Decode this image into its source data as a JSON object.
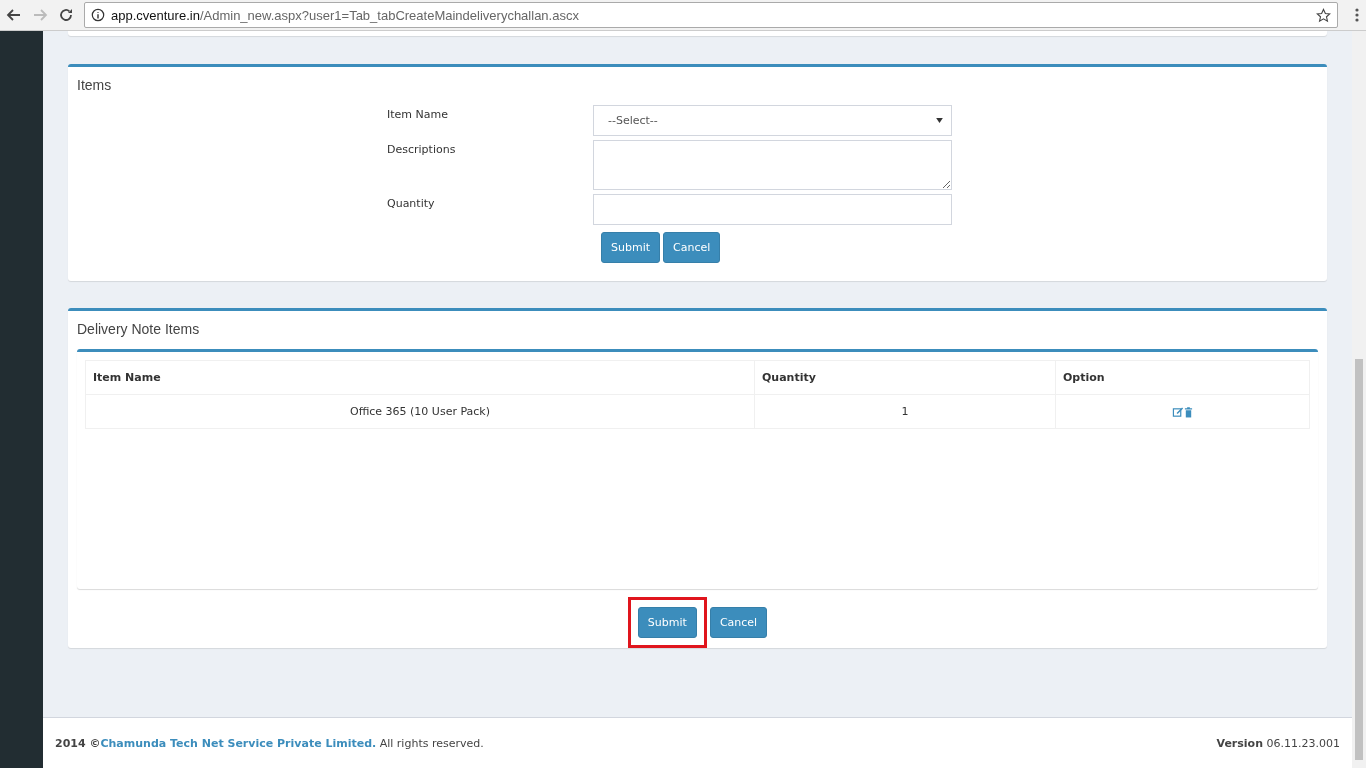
{
  "browser": {
    "url_host": "app.cventure.in",
    "url_path": "/Admin_new.aspx?user1=Tab_tabCreateMaindeliverychallan.ascx"
  },
  "items_form": {
    "title": "Items",
    "fields": [
      {
        "kind": "select",
        "label": "Item Name",
        "value": "--Select--"
      },
      {
        "kind": "textarea",
        "label": "Descriptions"
      },
      {
        "kind": "text",
        "label": "Quantity"
      }
    ],
    "buttons": [
      {
        "label": "Submit"
      },
      {
        "label": "Cancel"
      }
    ]
  },
  "delivery_items": {
    "title": "Delivery Note Items",
    "columns": [
      "Item Name",
      "Quantity",
      "Option"
    ],
    "rows": [
      {
        "item_name": "Office 365 (10 User Pack)",
        "quantity": "1"
      }
    ],
    "buttons": [
      {
        "label": "Submit",
        "highlighted": true
      },
      {
        "label": "Cancel",
        "highlighted": false
      }
    ]
  },
  "footer": {
    "year": "2014 ©",
    "company": "Chamunda Tech Net Service Private Limited.",
    "rights": " All rights reserved.",
    "version_label": "Version",
    "version": "06.11.23.001"
  }
}
